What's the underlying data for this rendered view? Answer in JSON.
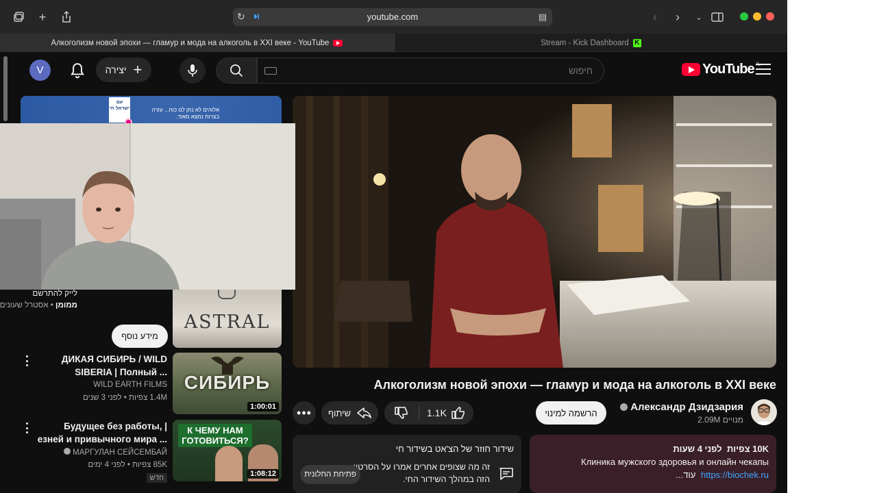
{
  "browser": {
    "url": "youtube.com",
    "tabs": [
      {
        "label": "Алкоголизм новой эпохи — гламур и мода на алкоголь в XXI веке - YouTube",
        "active": true
      },
      {
        "label": "Stream - Kick Dashboard",
        "active": false
      }
    ]
  },
  "header": {
    "avatar_letter": "V",
    "create_label": "יצירה",
    "search_placeholder": "חיפוש",
    "logo_text": "YouTube",
    "logo_region": "IL"
  },
  "sidebar": {
    "ad": {
      "flag_text": "עם ישראל חי",
      "text": "אלוהים לא נתן לנו כוח... עזרה בצרות נמצא מאוד."
    },
    "sponsored": {
      "line": "לייק להתרשם",
      "badge": "ממומן",
      "channel": "אסטרל שעונים",
      "thumb_text": "ASTRAL",
      "more_info_label": "מידע נוסף"
    },
    "recommendations": [
      {
        "title": "ДИКАЯ СИБИРЬ / WILD SIBERIA | Полный ...",
        "channel": "WILD EARTH FILMS",
        "views": "1.4M צפיות",
        "age": "לפני 3 שנים",
        "duration": "1:00:01",
        "thumb_text": "СИБИРЬ"
      },
      {
        "title": "Будущее без работы, | езней и привычного мира ...",
        "channel": "МАРГУЛАН СЕЙСЕМБАЙ",
        "views": "85K צפיות",
        "age": "לפני 4 ימים",
        "duration": "1:08:12",
        "badge": "חדש",
        "thumb_text": "К ЧЕМУ НАМ ГОТОВИТЬСЯ?"
      }
    ]
  },
  "video": {
    "title": "Алкоголизм новой эпохи — гламур и мода на алкоголь в XXI веке",
    "channel": "Александр Дзидзария",
    "subscribers": "2.09M מנויים",
    "subscribe_label": "הרשמה למינוי",
    "likes": "1.1K",
    "share_label": "שיתוף"
  },
  "description": {
    "views": "10K צפיות",
    "age": "לפני 4 שעות",
    "line1": "Клиника мужского здоровья и онлайн чекапы",
    "link": "https://biochek.ru",
    "more": "...עוד"
  },
  "chat_replay": {
    "heading": "שידור חוזר של הצ'אט בשידור חי",
    "body": "זה מה שצופים אחרים אמרו על הסרטון הזה במהלך השידור החי.",
    "open_label": "פתיחת החלונית"
  },
  "colors": {
    "yt_red": "#ff0033",
    "background": "#0f0f0f",
    "link_blue": "#3ea6ff",
    "kick_green": "#53fc18"
  }
}
